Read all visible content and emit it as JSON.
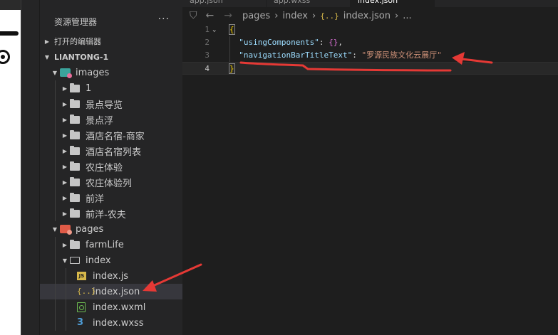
{
  "sidebar": {
    "title": "资源管理器",
    "more": "···",
    "open_editors": "打开的编辑器",
    "project": "LIANTONG-1",
    "images_folder": "images",
    "image_subfolders": [
      "1",
      "景点导览",
      "景点浮",
      "酒店名宿-商家",
      "酒店名宿列表",
      "农庄体验",
      "农庄体验列",
      "前洋",
      "前洋-农夫"
    ],
    "pages_folder": "pages",
    "farmlife_folder": "farmLife",
    "index_folder": "index",
    "index_files": [
      "index.js",
      "index.json",
      "index.wxml",
      "index.wxss"
    ]
  },
  "tabs": [
    "app.json",
    "app.wxss",
    "index.json"
  ],
  "breadcrumb": {
    "pages": "pages",
    "index": "index",
    "json_icon": "{..}",
    "file": "index.json",
    "rest": "..."
  },
  "code": {
    "line_numbers": [
      "1",
      "2",
      "3",
      "4"
    ],
    "open_brace": "{",
    "key1": "\"usingComponents\"",
    "val1": "{}",
    "key2": "\"navigationBarTitleText\"",
    "val2": "\"罗源民族文化云展厅\"",
    "close_brace": "}"
  },
  "colors": {
    "annotation": "#e53935",
    "json_string": "#ce9178",
    "json_key": "#9cdcfe"
  }
}
